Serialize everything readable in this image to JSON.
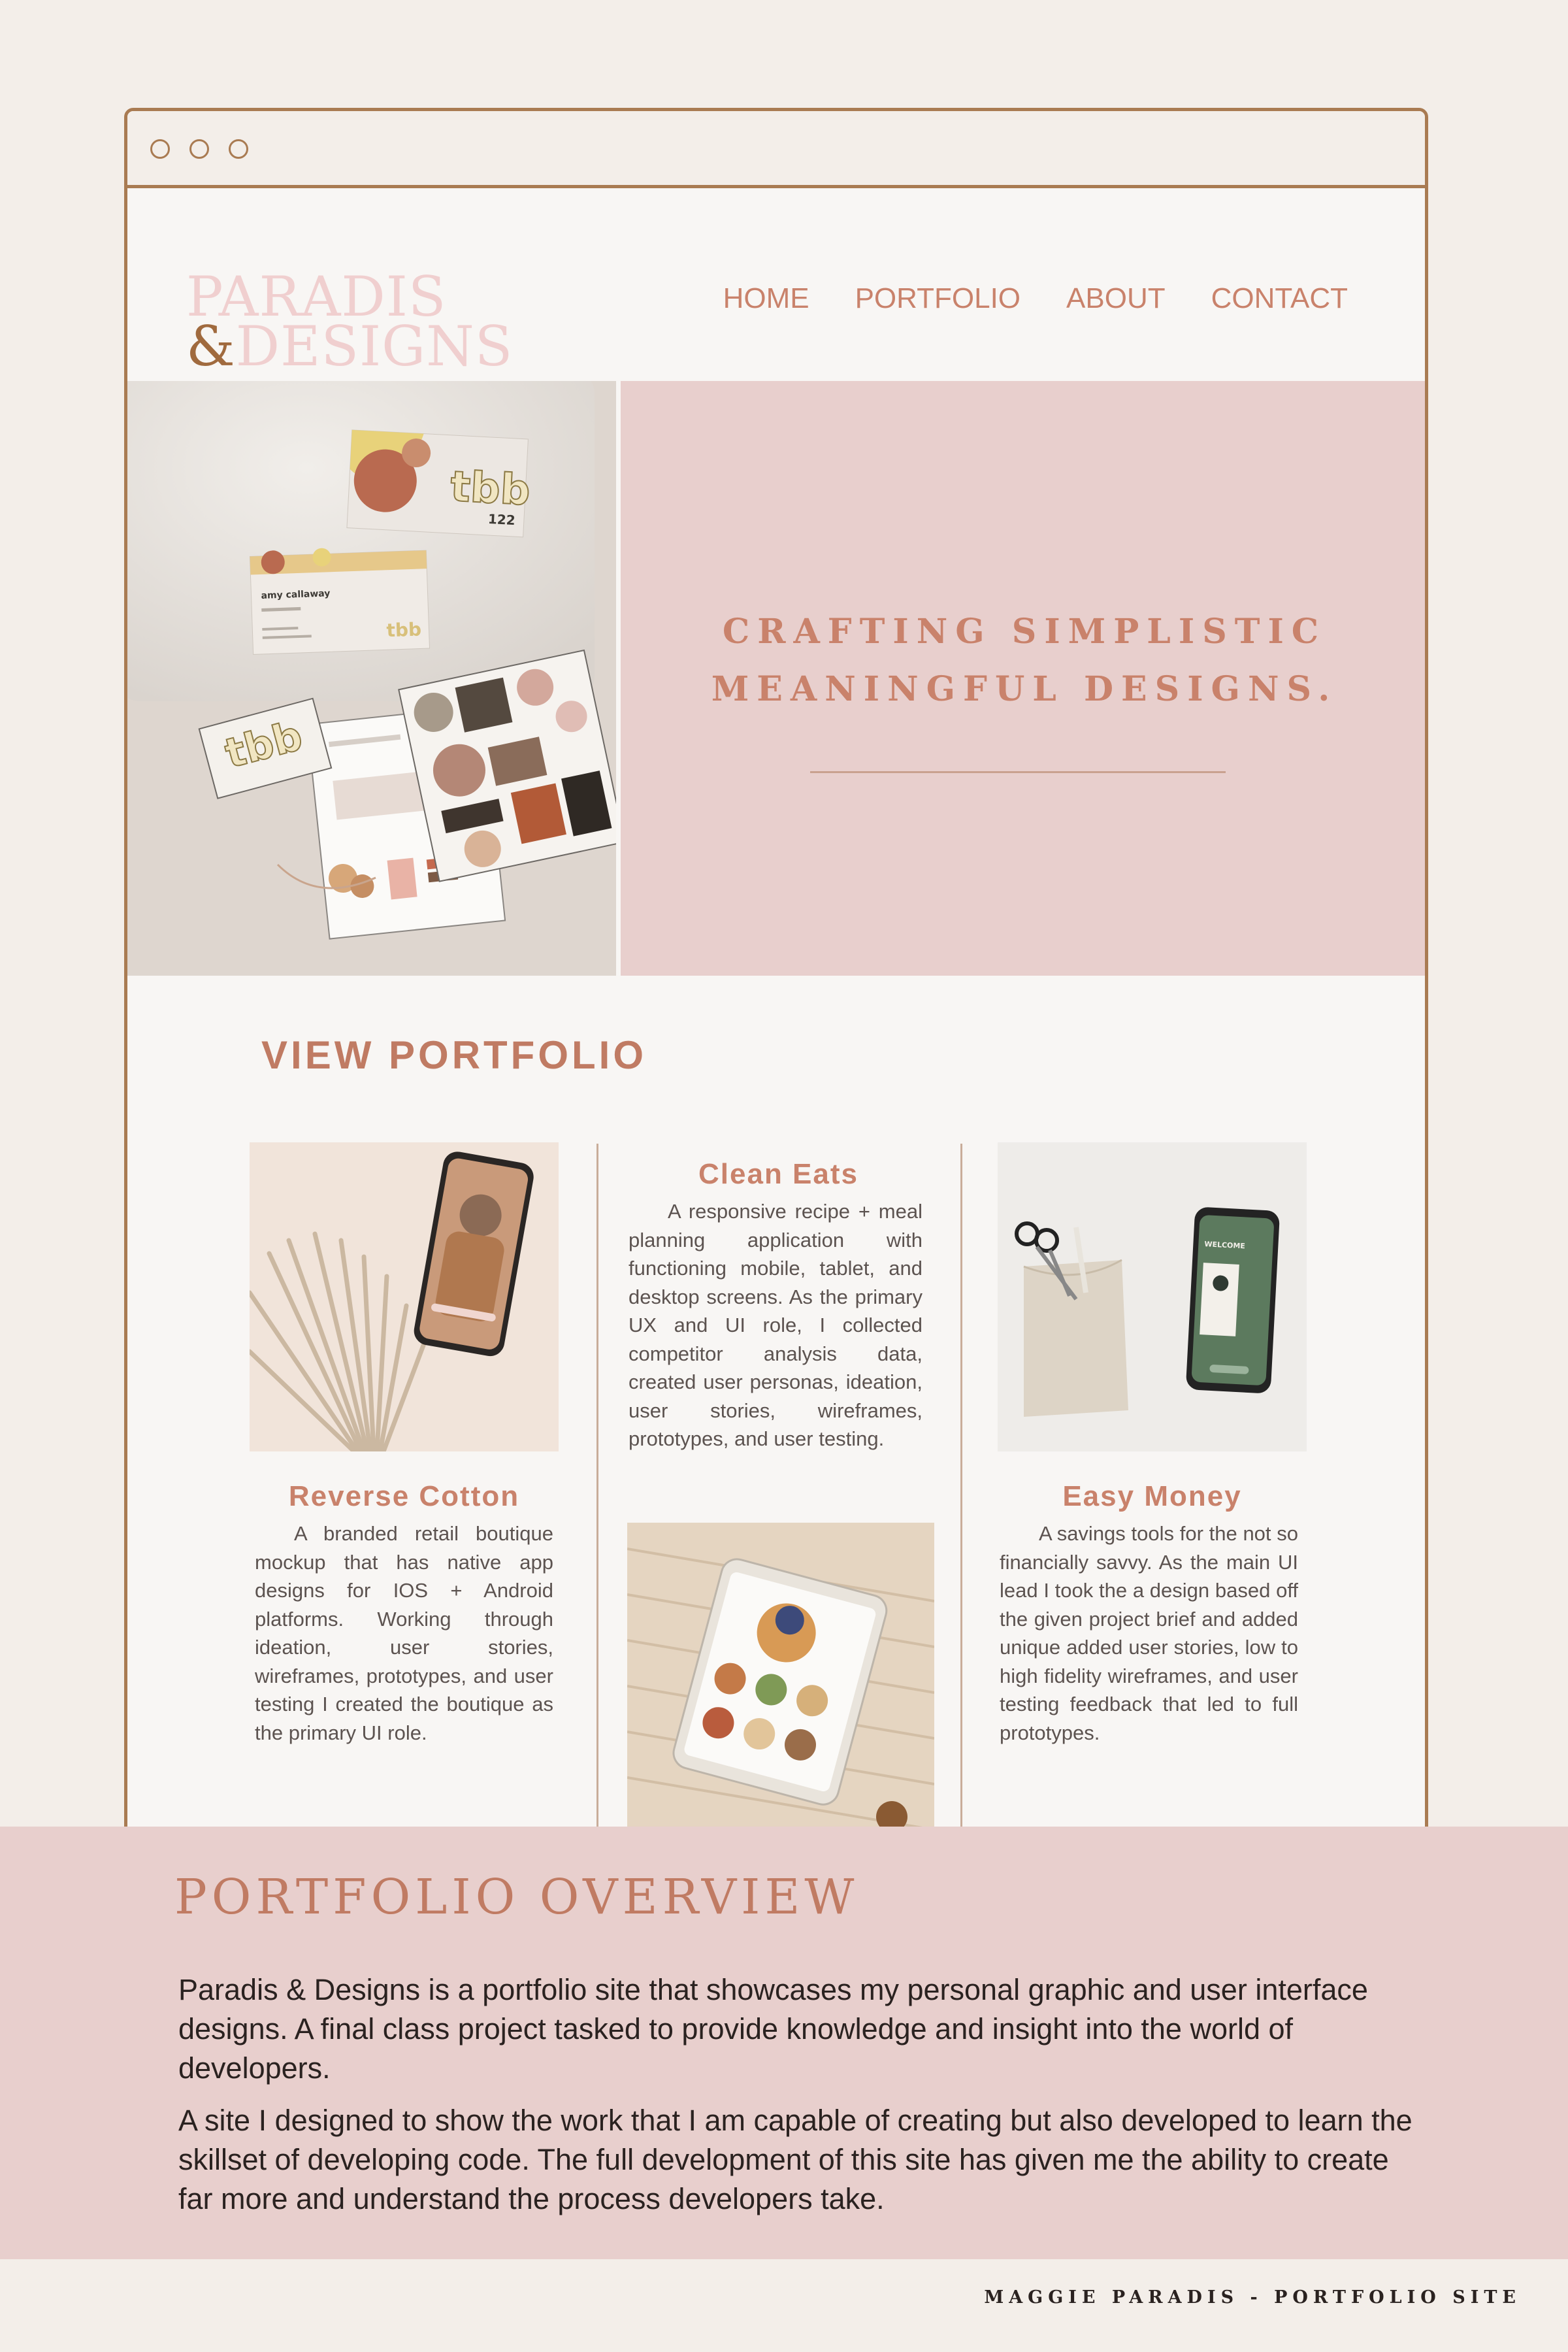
{
  "window": {
    "controls": [
      "close",
      "minimize",
      "maximize"
    ]
  },
  "logo": {
    "line1": "PARADIS",
    "ampersand": "&",
    "line2": "DESIGNS"
  },
  "nav": [
    "HOME",
    "PORTFOLIO",
    "ABOUT",
    "CONTACT"
  ],
  "hero": {
    "tagline_line1": "CRAFTING SIMPLISTIC",
    "tagline_line2": "MEANINGFUL DESIGNS.",
    "card_brand": "tbb",
    "card_number": "122",
    "card_name": "amy callaway"
  },
  "portfolio": {
    "heading": "VIEW PORTFOLIO",
    "cards": [
      {
        "title": "Reverse Cotton",
        "description": "A branded retail boutique mockup that has native app designs for IOS + Android platforms. Working through ideation, user stories, wireframes, prototypes, and user testing I created the boutique as the primary UI role."
      },
      {
        "title": "Clean Eats",
        "description": "A responsive recipe + meal planning application with functioning mobile, tablet, and desktop screens. As the primary UX and UI role, I collected competitor analysis data, created user personas, ideation, user stories, wireframes, prototypes, and user testing."
      },
      {
        "title": "Easy Money",
        "description": "A savings tools for the not so financially savvy. As the main UI lead I took the a design based off the given project brief and added unique added user stories, low to high fidelity wireframes, and user testing feedback that led to full prototypes.",
        "phone_screen_text": "WELCOME"
      }
    ]
  },
  "overview": {
    "title": "PORTFOLIO OVERVIEW",
    "paragraphs": [
      "Paradis & Designs is a portfolio site that showcases my personal graphic and user interface designs. A final class project tasked to provide knowledge and insight into the world of developers.",
      "A site I designed to show the work that I am capable of creating but also developed to learn the skillset of developing code. The full development of this site has given me the ability to create far more and understand the process developers take."
    ]
  },
  "caption": "MAGGIE PARADIS - PORTFOLIO SITE",
  "colors": {
    "frame": "#a97b52",
    "accent": "#c9826b",
    "blush": "#e8cfcd",
    "background": "#f3eee9"
  }
}
